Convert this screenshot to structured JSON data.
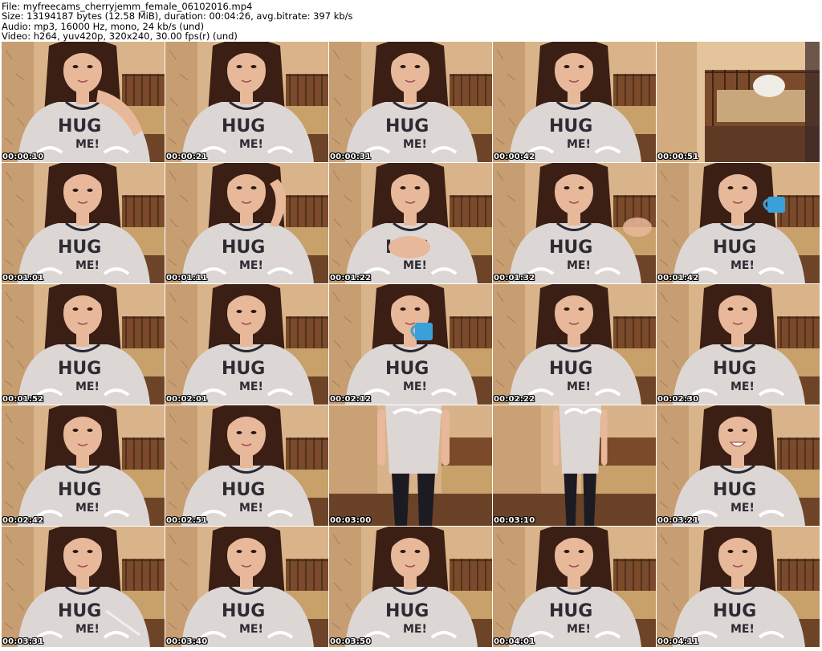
{
  "header": {
    "file_line": "File: myfreecams_cherryjemm_female_06102016.mp4",
    "size_line": "Size: 13194187 bytes (12.58 MiB), duration: 00:04:26, avg.bitrate: 397 kb/s",
    "audio_line": "Audio: mp3, 16000 Hz, mono, 24 kb/s (und)",
    "video_line": "Video: h264, yuv420p, 320x240, 30.00 fps(r) (und)"
  },
  "thumbnails": [
    {
      "time": "00:00:10",
      "kind": "person",
      "hand": "right"
    },
    {
      "time": "00:00:21",
      "kind": "person"
    },
    {
      "time": "00:00:31",
      "kind": "person"
    },
    {
      "time": "00:00:42",
      "kind": "person"
    },
    {
      "time": "00:00:51",
      "kind": "empty-room"
    },
    {
      "time": "00:01:01",
      "kind": "person",
      "look": "down"
    },
    {
      "time": "00:01:11",
      "kind": "person",
      "hand": "head"
    },
    {
      "time": "00:01:22",
      "kind": "person",
      "hand": "chest"
    },
    {
      "time": "00:01:32",
      "kind": "person",
      "hand": "wave"
    },
    {
      "time": "00:01:42",
      "kind": "person",
      "cup": "right"
    },
    {
      "time": "00:01:52",
      "kind": "person"
    },
    {
      "time": "00:02:01",
      "kind": "person",
      "look": "down"
    },
    {
      "time": "00:02:12",
      "kind": "person",
      "cup": "center"
    },
    {
      "time": "00:02:22",
      "kind": "person"
    },
    {
      "time": "00:02:30",
      "kind": "person"
    },
    {
      "time": "00:02:42",
      "kind": "person"
    },
    {
      "time": "00:02:51",
      "kind": "person",
      "look": "down"
    },
    {
      "time": "00:03:00",
      "kind": "standing"
    },
    {
      "time": "00:03:10",
      "kind": "standing-far"
    },
    {
      "time": "00:03:21",
      "kind": "person",
      "smile": "wide"
    },
    {
      "time": "00:03:31",
      "kind": "person",
      "pen": "true"
    },
    {
      "time": "00:03:40",
      "kind": "person"
    },
    {
      "time": "00:03:50",
      "kind": "person"
    },
    {
      "time": "00:04:01",
      "kind": "person"
    },
    {
      "time": "00:04:11",
      "kind": "person"
    }
  ],
  "colors": {
    "wall": "#d9b48a",
    "wall_dark": "#b88a5e",
    "bed": "#7a4a2a",
    "bedding": "#c8a06a",
    "shirt": "#dcd7d4",
    "shirt_text": "#2e2b33",
    "skin": "#e7b89a",
    "hair": "#3b1e14",
    "cup": "#3aa0d8",
    "leggings": "#1d1b22"
  }
}
